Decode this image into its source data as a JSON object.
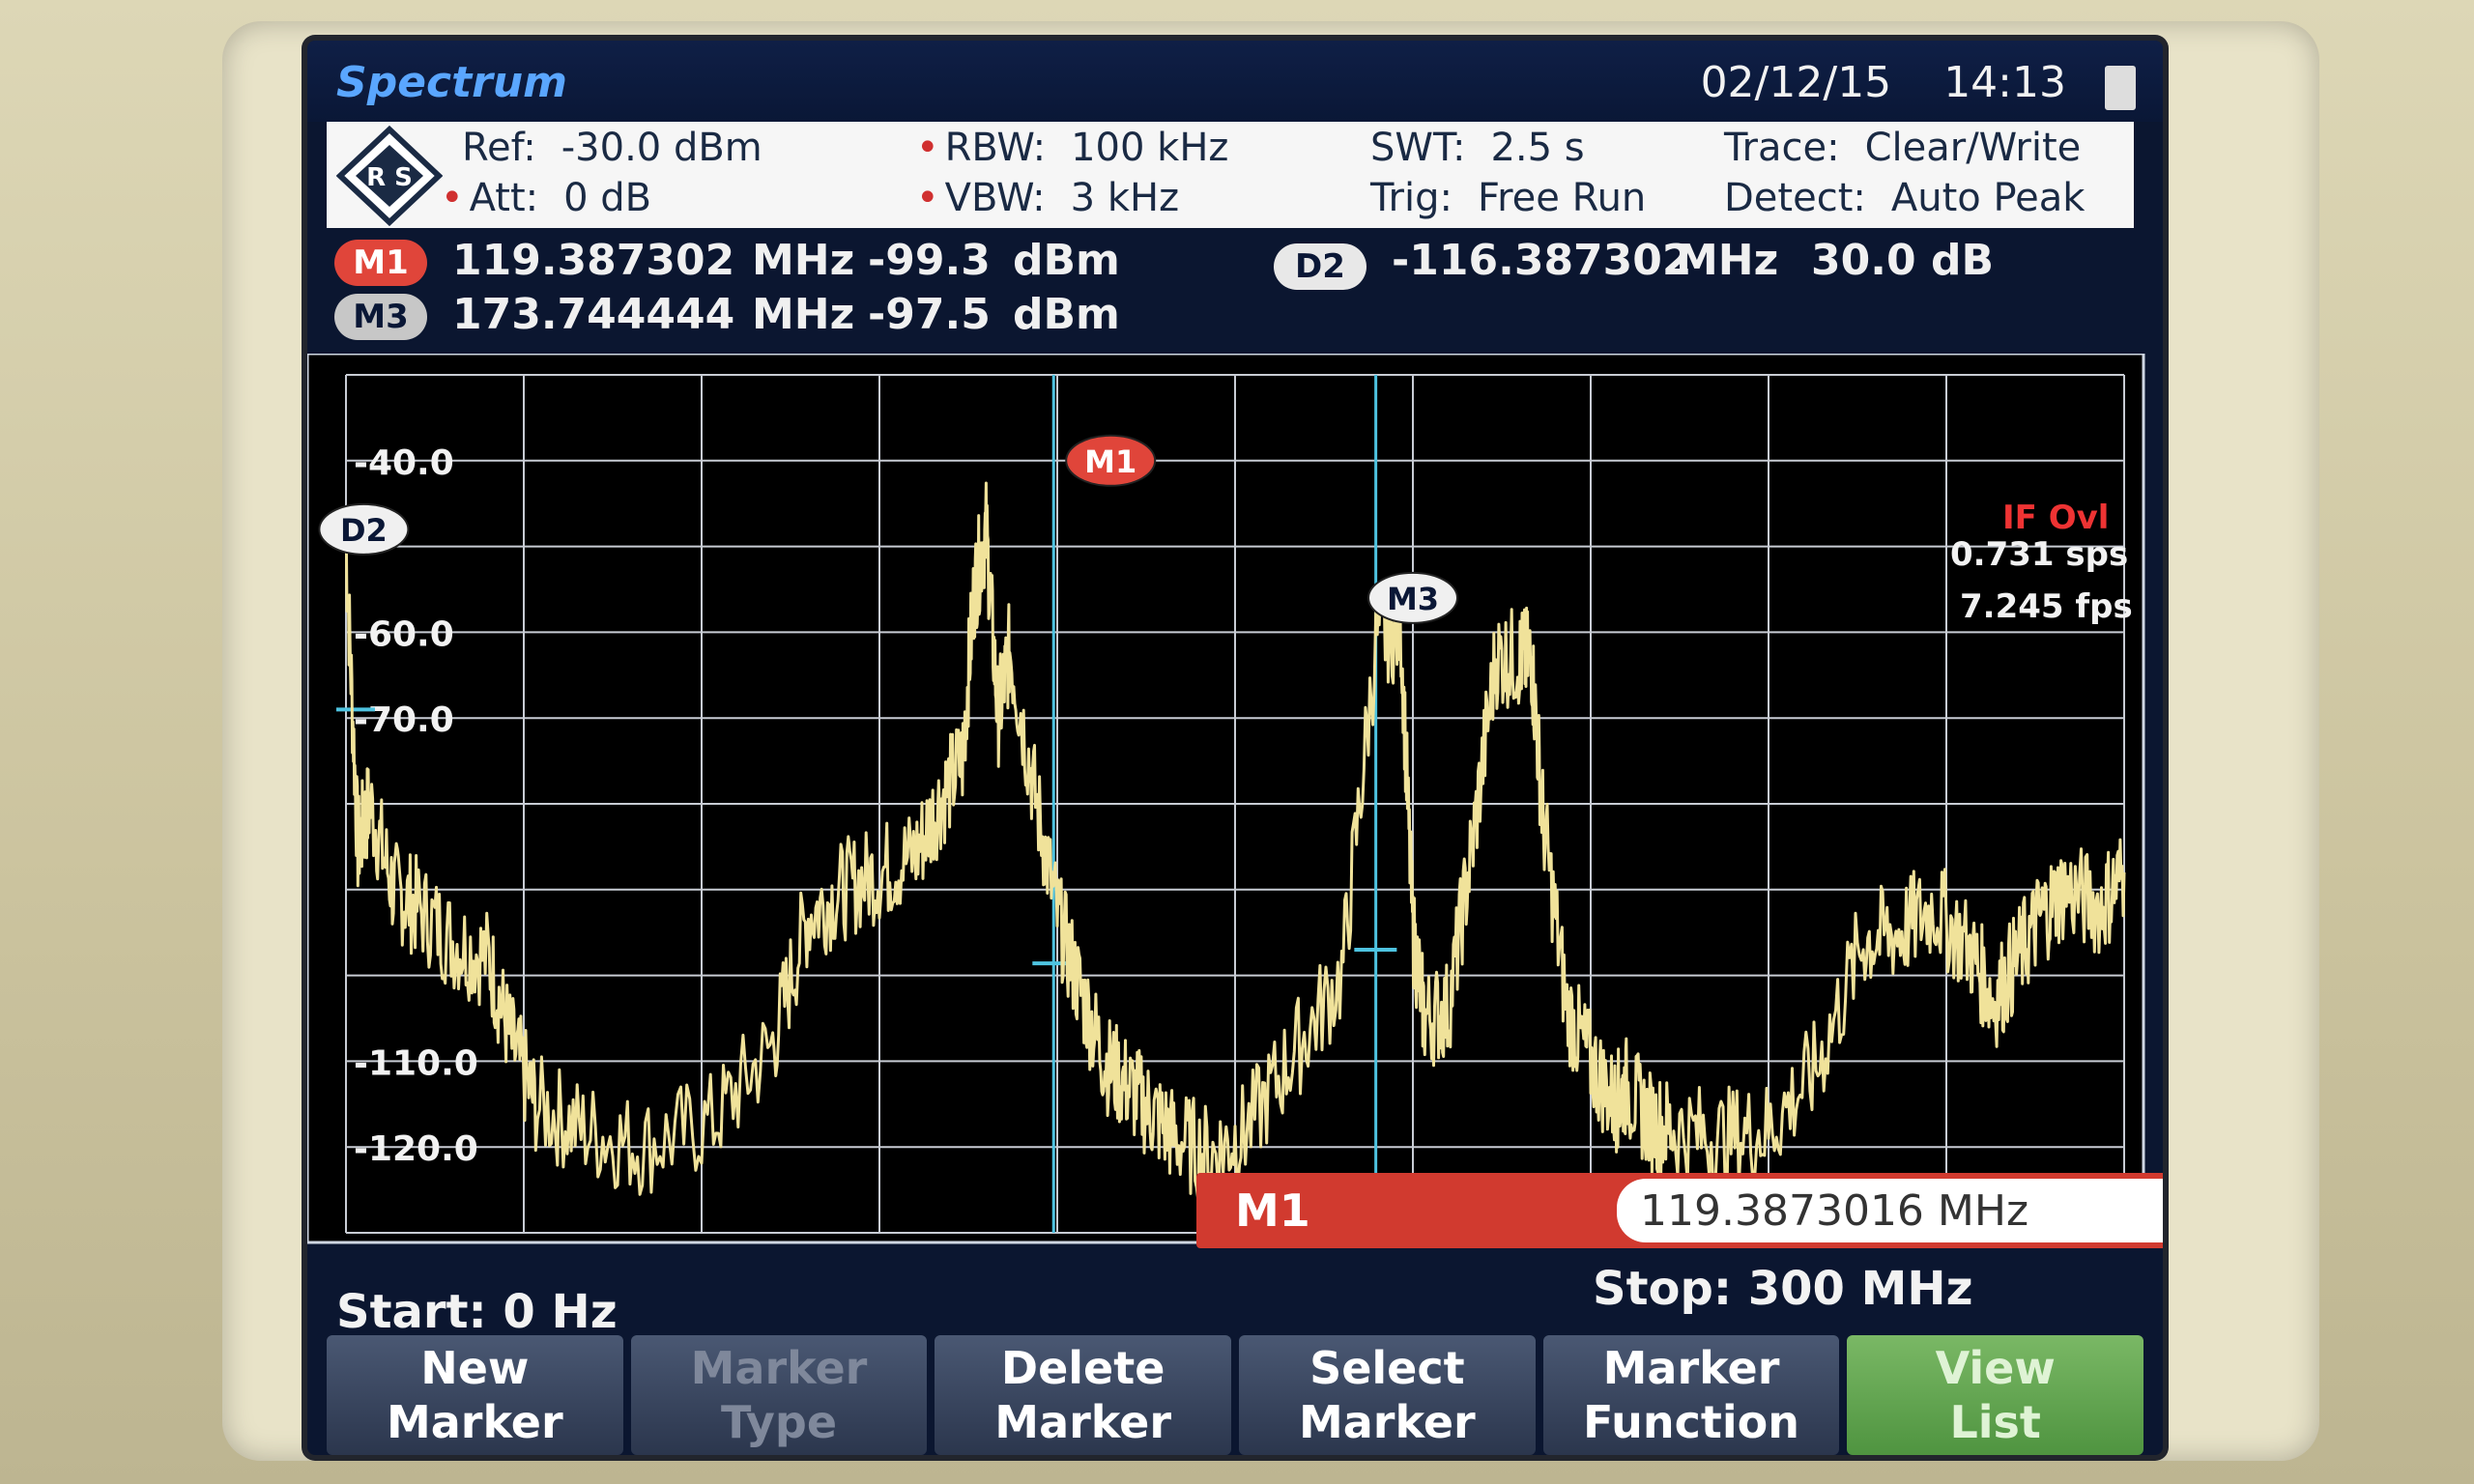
{
  "header": {
    "mode": "Spectrum",
    "date": "02/12/15",
    "time": "14:13"
  },
  "params": {
    "ref_label": "Ref:",
    "ref_value": "-30.0 dBm",
    "att_label": "Att:",
    "att_value": "0 dB",
    "rbw_label": "RBW:",
    "rbw_value": "100 kHz",
    "vbw_label": "VBW:",
    "vbw_value": "3 kHz",
    "swt_label": "SWT:",
    "swt_value": "2.5 s",
    "trig_label": "Trig:",
    "trig_value": "Free Run",
    "trace_label": "Trace:",
    "trace_value": "Clear/Write",
    "detect_label": "Detect:",
    "detect_value": "Auto Peak"
  },
  "markers": {
    "m1": {
      "tag": "M1",
      "freq": "119.387302",
      "freq_unit": "MHz",
      "level": "-99.3",
      "level_unit": "dBm"
    },
    "m3": {
      "tag": "M3",
      "freq": "173.744444",
      "freq_unit": "MHz",
      "level": "-97.5",
      "level_unit": "dBm"
    },
    "d2": {
      "tag": "D2",
      "freq": "-116.387302",
      "freq_unit": "MHz",
      "level": "30.0",
      "level_unit": "dB"
    }
  },
  "overlay": {
    "if_ovl": "IF Ovl",
    "sps": "0.731 sps",
    "fps": "7.245 fps"
  },
  "marker_entry": {
    "label": "M1",
    "value": "119.3873016 MHz"
  },
  "sweep": {
    "start": "Start:  0 Hz",
    "stop": "Stop: 300 MHz"
  },
  "softkeys": [
    {
      "label": "New\nMarker",
      "state": "normal"
    },
    {
      "label": "Marker\nType",
      "state": "disabled"
    },
    {
      "label": "Delete\nMarker",
      "state": "normal"
    },
    {
      "label": "Select\nMarker",
      "state": "normal"
    },
    {
      "label": "Marker\nFunction",
      "state": "normal"
    },
    {
      "label": "View\nList",
      "state": "active"
    }
  ],
  "chart_data": {
    "type": "line",
    "xlim": [
      0,
      300
    ],
    "ylim": [
      -130,
      -30
    ],
    "y_ticks": [
      {
        "value": -40,
        "label": "-40.0"
      },
      {
        "value": -60,
        "label": "-60.0"
      },
      {
        "value": -70,
        "label": "-70.0"
      },
      {
        "value": -110,
        "label": "-110.0"
      },
      {
        "value": -120,
        "label": "-120.0"
      }
    ],
    "grid": true,
    "trace_color": "#f0e29a",
    "series": [
      {
        "x": [
          0,
          2,
          4,
          8,
          12,
          18,
          24,
          28,
          32,
          40,
          50,
          62,
          72,
          78,
          84,
          90,
          96,
          100,
          104,
          106,
          108,
          110,
          112,
          116,
          120,
          124,
          128,
          132,
          136,
          140,
          146,
          152,
          160,
          168,
          174,
          178,
          180,
          182,
          186,
          190,
          194,
          198,
          200,
          202,
          206,
          210,
          214,
          216,
          220,
          224,
          232,
          240,
          248,
          256,
          262,
          268,
          274,
          278,
          282,
          286,
          290,
          296,
          300
        ],
        "y": [
          -50,
          -85,
          -80,
          -90,
          -92,
          -96,
          -98,
          -108,
          -115,
          -118,
          -120,
          -117,
          -108,
          -93,
          -90,
          -88,
          -86,
          -80,
          -75,
          -55,
          -48,
          -70,
          -62,
          -78,
          -93,
          -102,
          -110,
          -113,
          -116,
          -119,
          -121,
          -118,
          -109,
          -100,
          -60,
          -60,
          -95,
          -105,
          -104,
          -85,
          -63,
          -63,
          -63,
          -82,
          -104,
          -110,
          -115,
          -113,
          -117,
          -118,
          -119,
          -118,
          -111,
          -96,
          -95,
          -92,
          -97,
          -103,
          -98,
          -93,
          -90,
          -92,
          -88
        ]
      }
    ],
    "marker_lines": [
      {
        "name": "M1",
        "x": 119.387302,
        "y": -99.3
      },
      {
        "name": "M3",
        "x": 173.744444,
        "y": -97.5
      }
    ],
    "marker_flags": [
      {
        "name": "M1",
        "x": 129,
        "y": -40
      },
      {
        "name": "M3",
        "x": 180,
        "y": -56
      },
      {
        "name": "D2",
        "x": 3,
        "y": -48
      }
    ],
    "ref_line": {
      "y": -69
    },
    "threshold_ticks": [
      {
        "x": 119.4,
        "y": -98.6
      },
      {
        "x": 173.7,
        "y": -97
      }
    ]
  }
}
